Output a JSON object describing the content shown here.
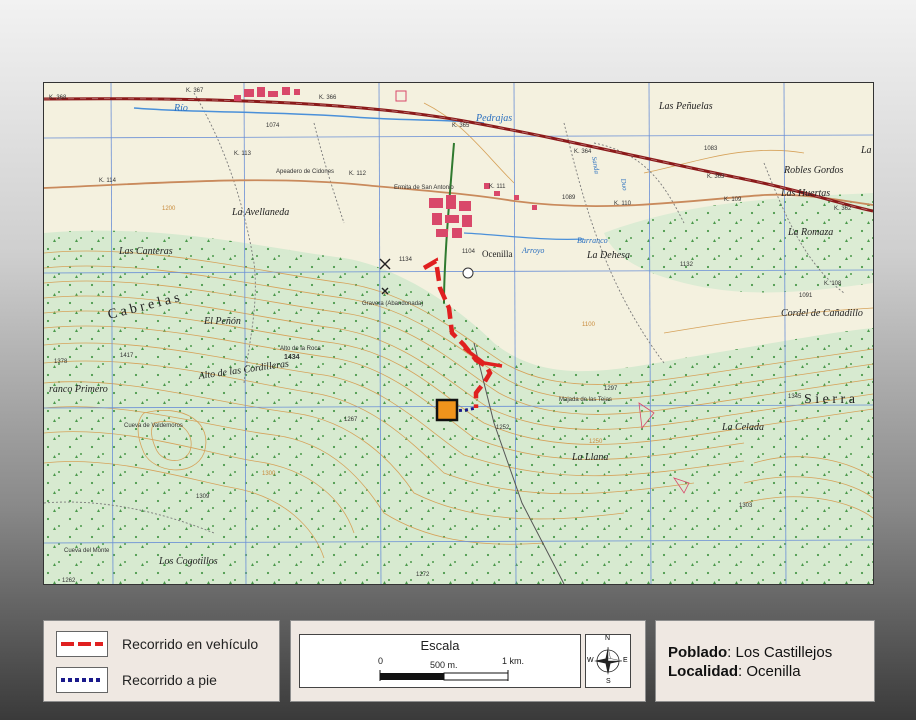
{
  "map": {
    "labels": {
      "rio": "Río",
      "pedrajas": "Pedrajas",
      "las_penuelas": "Las Peñuelas",
      "robles_gordos": "Robles Gordos",
      "las_huertas": "Las Huertas",
      "la_romaza": "La Romaza",
      "cordel": "Cordel de Cañadillo",
      "la_avellaneda": "La Avellaneda",
      "las_canteras": "Las Canteras",
      "cabrelas": "C a b r e l a s",
      "el_penon": "El Peñón",
      "alto_cordilleras": "Alto de las Cordilleras",
      "alto_roca": "Alto de la Roca",
      "peak_1434": "1434",
      "blanco_primero": "ranco Primero",
      "la_dehesa": "La Dehesa",
      "ocenilla_town": "Ocenilla",
      "arroyo": "Arroyo",
      "barranco": "Barranco",
      "sierra": "S i e r r a",
      "la_celada": "La Celada",
      "la_llana": "La Llana",
      "los_cogotillos": "Los Cogotillos",
      "cueva_del_monte": "Cueva del Monte",
      "apeadero": "Apeadero de Cidones",
      "ermita": "Ermita de San Antonio",
      "gravera": "Gravera (Abandonada)",
      "cueva_valdemoros": "Cueva de Valdemoros",
      "majada": "Majada de las Tejas",
      "km_368": "K. 368",
      "km_367": "K. 367",
      "km_366": "K. 366",
      "km_365": "K. 365",
      "km_364": "K. 364",
      "km_363": "K. 363",
      "km_362": "K. 362",
      "km_113": "K. 113",
      "km_112": "K. 112",
      "km_111": "K. 111",
      "km_110": "K. 110",
      "km_109": "K. 109",
      "km_108": "K. 108",
      "km_114": "K. 114",
      "elev_1074": "1074",
      "elev_1083": "1083",
      "elev_1089": "1089",
      "elev_1104": "1104",
      "elev_1134": "1134",
      "elev_1091": "1091",
      "elev_1297": "1297",
      "elev_1252": "1252",
      "elev_1267": "1267",
      "elev_1309": "1309",
      "elev_1303": "1303",
      "elev_1272": "1272",
      "elev_1262": "1262",
      "elev_1345": "1345",
      "elev_1378": "1378",
      "elev_1417": "1417",
      "elev_1132": "1132",
      "elev_1200": "1200",
      "elev_1100": "1100",
      "elev_1250": "1250",
      "elev_1300": "1300",
      "la": "La",
      "sanda": "Sanda",
      "duo": "Duo"
    },
    "colors": {
      "paper": "#f4f1df",
      "forest": "#d7ead0",
      "contour": "#d6a25a",
      "grid": "#6a8fd6",
      "road": "#8b1a1a",
      "town": "#d9486a",
      "river": "#4a90d9",
      "vehicle_route": "#e02020",
      "foot_route": "#1a1a8c",
      "site_marker": "#f0941c"
    }
  },
  "legend": {
    "vehicle_label": "Recorrido en vehículo",
    "foot_label": "Recorrido a pie"
  },
  "scale": {
    "title": "Escala",
    "tick_0": "0",
    "tick_500": "500 m.",
    "tick_1km": "1 km."
  },
  "compass": {
    "n": "N",
    "s": "S",
    "e": "E",
    "w": "W",
    "icon": "compass-rose-icon"
  },
  "info": {
    "poblado_key": "Poblado",
    "poblado_value": "Los Castillejos",
    "localidad_key": "Localidad",
    "localidad_value": "Ocenilla"
  }
}
